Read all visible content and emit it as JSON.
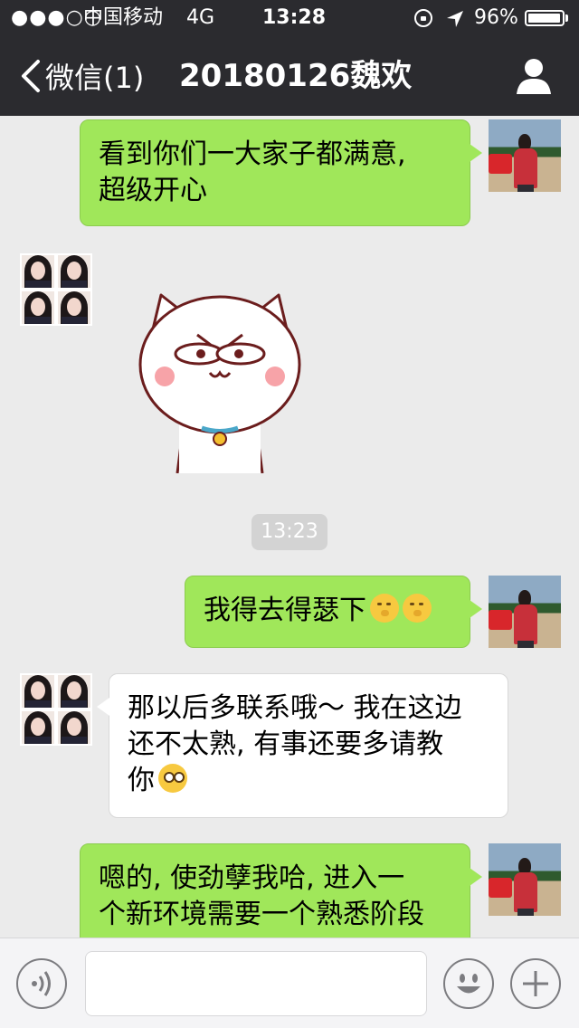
{
  "status_bar": {
    "signal": "●●●○○",
    "carrier": "中国移动",
    "network": "4G",
    "time": "13:28",
    "battery_percent": "96%",
    "battery_level": 0.96,
    "icons": [
      "rotation-lock-icon",
      "location-arrow-icon",
      "battery-icon"
    ]
  },
  "nav": {
    "back_label": "微信(1)",
    "title": "20180126魏欢",
    "icons": [
      "chevron-left-icon",
      "profile-icon"
    ]
  },
  "messages": [
    {
      "from": "me",
      "lines": [
        "看到你们一大家子都满意,",
        "超级开心"
      ]
    },
    {
      "from": "other",
      "type": "sticker",
      "sticker": "angry-cat-sticker"
    },
    {
      "from": "system",
      "time": "13:23"
    },
    {
      "from": "me",
      "text": "我得去得瑟下",
      "emoji": [
        "thinking-emoji",
        "thinking-emoji"
      ]
    },
    {
      "from": "other",
      "lines": [
        "那以后多联系哦～ 我在这边",
        "还不太熟, 有事还要多请教",
        "你"
      ],
      "emoji": [
        "pleading-emoji"
      ]
    },
    {
      "from": "me",
      "lines": [
        "嗯的, 使劲孽我哈, 进入一",
        "个新环境需要一个熟悉阶段"
      ]
    }
  ],
  "input_bar": {
    "text_value": "",
    "icons": [
      "voice-icon",
      "emoji-icon",
      "plus-icon"
    ]
  },
  "colors": {
    "header_bg": "#2b2b2f",
    "chat_bg": "#ebebeb",
    "sent_bubble": "#a0e75a",
    "received_bubble": "#ffffff",
    "time_badge": "#d3d3d3"
  }
}
